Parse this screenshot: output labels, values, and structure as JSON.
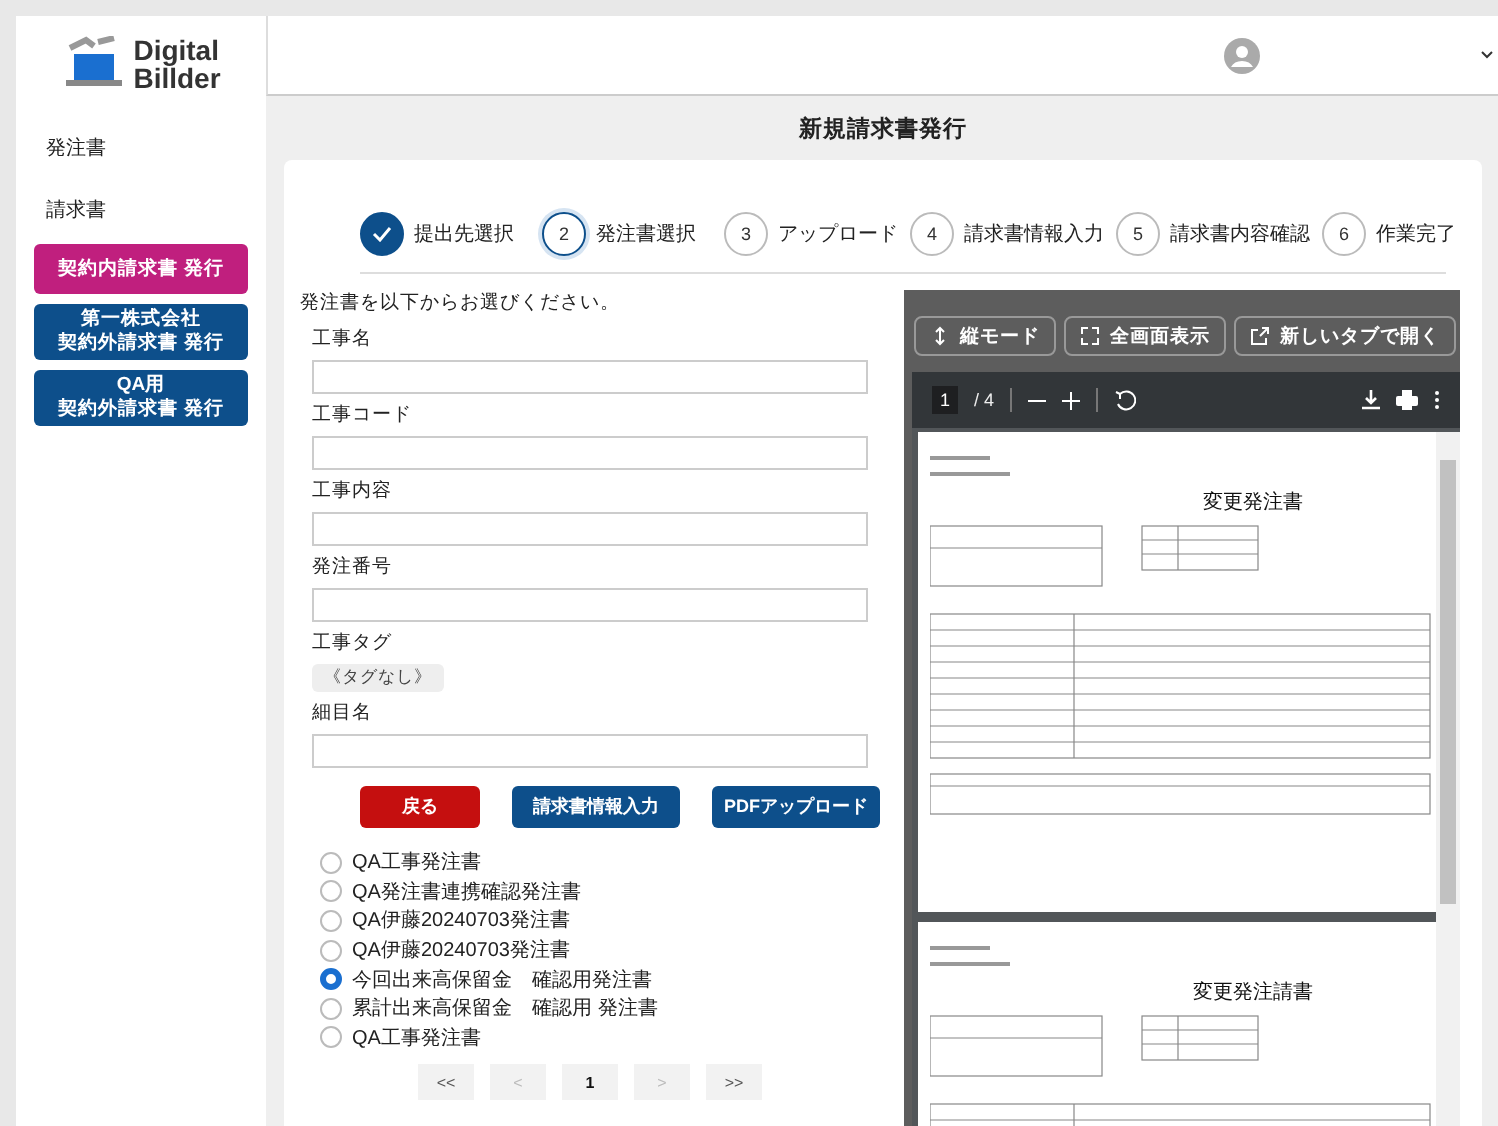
{
  "logo": {
    "line1": "Digital",
    "line2": "Billder"
  },
  "sidebar": {
    "links": [
      {
        "label": "発注書"
      },
      {
        "label": "請求書"
      }
    ],
    "actions": [
      {
        "lines": [
          "契約内請求書 発行"
        ],
        "kind": "magenta"
      },
      {
        "lines": [
          "第一株式会社",
          "契約外請求書 発行"
        ],
        "kind": "blue"
      },
      {
        "lines": [
          "QA用",
          "契約外請求書 発行"
        ],
        "kind": "blue"
      }
    ]
  },
  "page_title": "新規請求書発行",
  "steps": [
    {
      "label": "提出先選択",
      "completed": true,
      "selected": false
    },
    {
      "number": "2",
      "label": "発注書選択",
      "completed": false,
      "selected": true
    },
    {
      "number": "3",
      "label": "アップロード",
      "completed": false,
      "selected": false
    },
    {
      "number": "4",
      "label": "請求書情報入力",
      "completed": false,
      "selected": false
    },
    {
      "number": "5",
      "label": "請求書内容確認",
      "completed": false,
      "selected": false
    },
    {
      "number": "6",
      "label": "作業完了",
      "completed": false,
      "selected": false
    }
  ],
  "instruction": "発注書を以下からお選びください。",
  "fields": [
    {
      "label": "工事名",
      "kind": "input"
    },
    {
      "label": "工事コード",
      "kind": "input"
    },
    {
      "label": "工事内容",
      "kind": "input"
    },
    {
      "label": "発注番号",
      "kind": "input"
    },
    {
      "label": "工事タグ",
      "kind": "tag",
      "tag": "《タグなし》"
    },
    {
      "label": "細目名",
      "kind": "input"
    }
  ],
  "buttons": [
    {
      "label": "戻る",
      "kind": "danger"
    },
    {
      "label": "請求書情報入力",
      "kind": "primary"
    },
    {
      "label": "PDFアップロード",
      "kind": "primary"
    }
  ],
  "orders": [
    {
      "label": "QA工事発注書",
      "selected": false
    },
    {
      "label": "QA発注書連携確認発注書",
      "selected": false
    },
    {
      "label": "QA伊藤20240703発注書",
      "selected": false
    },
    {
      "label": "QA伊藤20240703発注書",
      "selected": false
    },
    {
      "label": "今回出来高保留金　確認用発注書",
      "selected": true
    },
    {
      "label": "累計出来高保留金　確認用 発注書",
      "selected": false
    },
    {
      "label": "QA工事発注書",
      "selected": false
    }
  ],
  "pagination": [
    {
      "label": "<<",
      "disabled": false,
      "selected": false
    },
    {
      "label": "<",
      "disabled": true,
      "selected": false
    },
    {
      "label": "1",
      "disabled": false,
      "selected": true
    },
    {
      "label": ">",
      "disabled": true,
      "selected": false
    },
    {
      "label": ">>",
      "disabled": false,
      "selected": false
    }
  ],
  "viewer": {
    "buttons": [
      {
        "label": "縦モード",
        "kind": "vertical"
      },
      {
        "label": "全画面表示",
        "kind": "fullscreen"
      },
      {
        "label": "新しいタブで開く",
        "kind": "newtab"
      }
    ],
    "page_number": "1",
    "page_total": "/ 4",
    "pages": [
      {
        "title": "変更発注書"
      },
      {
        "title": "変更発注請書"
      }
    ]
  }
}
